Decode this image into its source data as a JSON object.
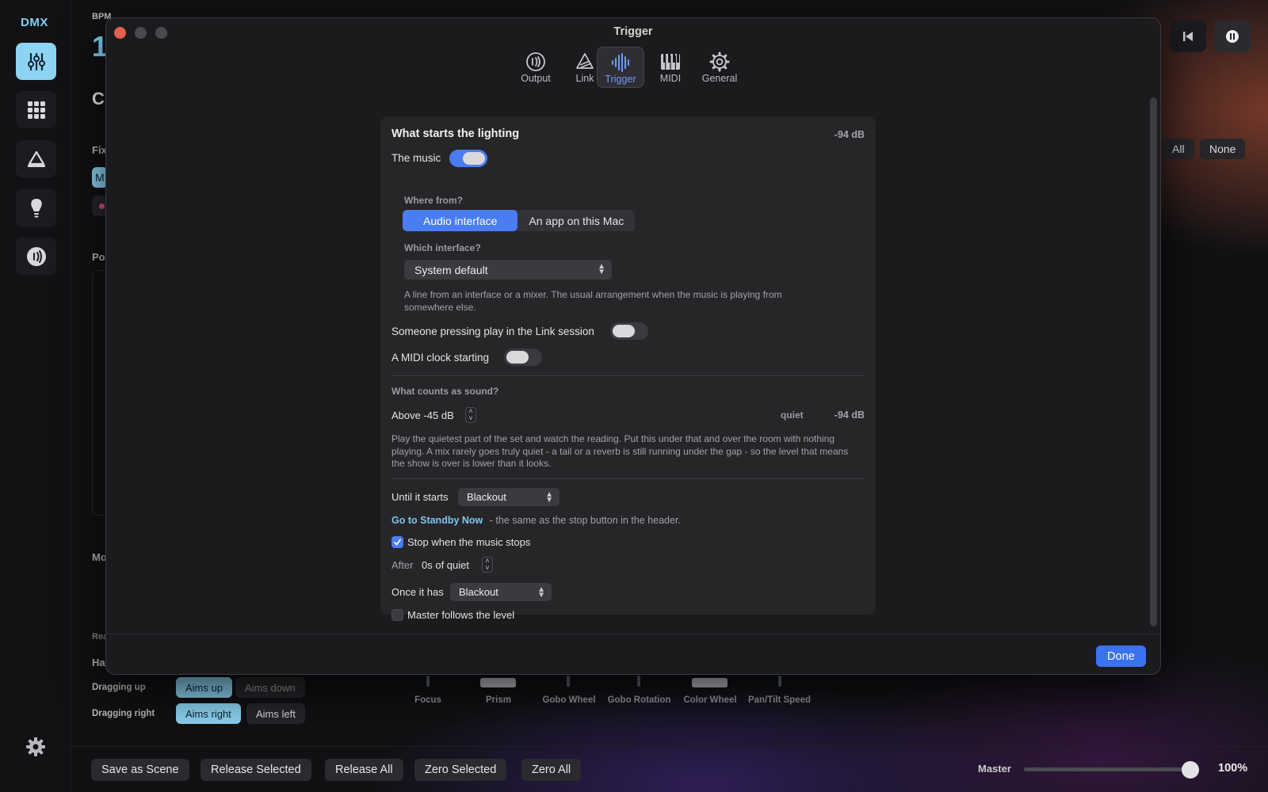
{
  "app": {
    "logo": "DMX",
    "bpm_label": "BPM",
    "bpm_value": "1",
    "bg_title": "C",
    "bg_fix_label": "Fix",
    "bg_po_label": "Po",
    "bg_mo_label": "Mo",
    "bg_rea_label": "Rea",
    "bg_ha_label": "Ha",
    "chip_all": "All",
    "chip_none": "None",
    "chip_m": "M",
    "dragging_up_label": "Dragging up",
    "dragging_right_label": "Dragging right",
    "aims_up": "Aims up",
    "aims_down": "Aims down",
    "aims_right": "Aims right",
    "aims_left": "Aims left",
    "faders": [
      "Focus",
      "Prism",
      "Gobo Wheel",
      "Gobo Rotation",
      "Color Wheel",
      "Pan/Tilt Speed"
    ],
    "bottom_buttons": {
      "save_scene": "Save as Scene",
      "release_selected": "Release Selected",
      "release_all": "Release All",
      "zero_selected": "Zero Selected",
      "zero_all": "Zero All"
    },
    "master_label": "Master",
    "master_value": "100%",
    "master_level": 1.0
  },
  "modal": {
    "title": "Trigger",
    "tabs": [
      {
        "label": "Output",
        "icon": "output-icon"
      },
      {
        "label": "Link",
        "icon": "link-icon"
      },
      {
        "label": "Trigger",
        "icon": "trigger-icon"
      },
      {
        "label": "MIDI",
        "icon": "midi-icon"
      },
      {
        "label": "General",
        "icon": "gear-icon"
      }
    ],
    "active_tab": "Trigger",
    "done_label": "Done"
  },
  "panel": {
    "heading": "What starts the lighting",
    "level_readout": "-94 dB",
    "music_label": "The music",
    "music_on": true,
    "where_from_label": "Where from?",
    "source_options": [
      "Audio interface",
      "An app on this Mac"
    ],
    "source_selected": "Audio interface",
    "which_interface_label": "Which interface?",
    "interface_value": "System default",
    "interface_help": "A line from an interface or a mixer. The usual arrangement when the music is playing from somewhere else.",
    "link_label": "Someone pressing play in the Link session",
    "link_on": false,
    "midi_label": "A MIDI clock starting",
    "midi_on": false,
    "sound_heading": "What counts as sound?",
    "threshold": "Above -45 dB",
    "quiet_label": "quiet",
    "quiet_readout": "-94 dB",
    "threshold_help": "Play the quietest part of the set and watch the reading. Put this under that and over the room with nothing playing. A mix rarely goes truly quiet - a tail or a reverb is still running under the gap - so the level that means the show is over is lower than it looks.",
    "until_label": "Until it starts",
    "until_value": "Blackout",
    "standby_link": "Go to Standby Now",
    "standby_help": "- the same as the stop button in the header.",
    "stop_label": "Stop when the music stops",
    "stop_checked": true,
    "after_label": "After",
    "after_value": "0s of quiet",
    "once_label": "Once it has",
    "once_value": "Blackout",
    "master_follows_label": "Master follows the level",
    "master_follows_checked": false
  },
  "colors": {
    "accent": "#4a7cf2",
    "sidebar_accent": "#8dd4f3",
    "close": "#e35f4f"
  }
}
